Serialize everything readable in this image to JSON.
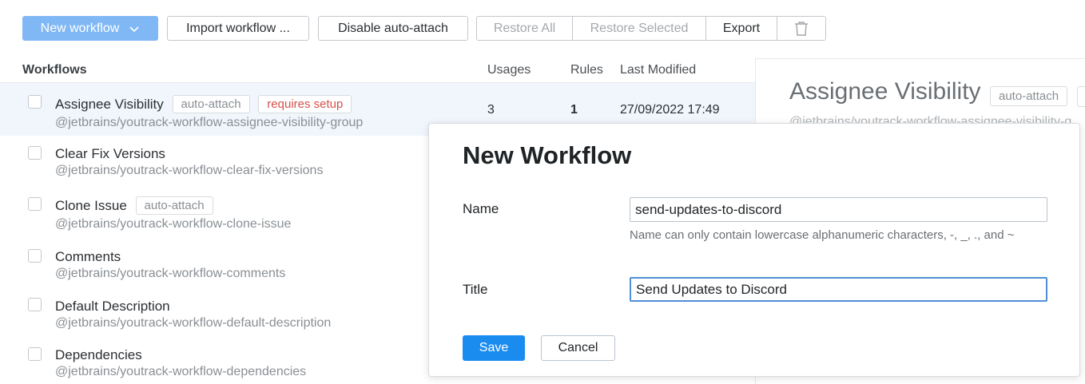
{
  "toolbar": {
    "new_workflow": "New workflow",
    "import_workflow": "Import workflow ...",
    "disable_auto_attach": "Disable auto-attach",
    "restore_all": "Restore All",
    "restore_selected": "Restore Selected",
    "export": "Export"
  },
  "table": {
    "headers": {
      "workflows": "Workflows",
      "usages": "Usages",
      "rules": "Rules",
      "last_modified": "Last Modified"
    },
    "rows": [
      {
        "title": "Assignee Visibility",
        "package": "@jetbrains/youtrack-workflow-assignee-visibility-group",
        "tags": [
          "auto-attach",
          "requires setup"
        ],
        "usages": "3",
        "rules": "1",
        "modified": "27/09/2022 17:49"
      },
      {
        "title": "Clear Fix Versions",
        "package": "@jetbrains/youtrack-workflow-clear-fix-versions"
      },
      {
        "title": "Clone Issue",
        "package": "@jetbrains/youtrack-workflow-clone-issue",
        "tags": [
          "auto-attach"
        ]
      },
      {
        "title": "Comments",
        "package": "@jetbrains/youtrack-workflow-comments"
      },
      {
        "title": "Default Description",
        "package": "@jetbrains/youtrack-workflow-default-description"
      },
      {
        "title": "Dependencies",
        "package": "@jetbrains/youtrack-workflow-dependencies"
      }
    ]
  },
  "side_panel": {
    "title": "Assignee Visibility",
    "tag": "auto-attach",
    "package": "@jetbrains/youtrack-workflow-assignee-visibility-g"
  },
  "dialog": {
    "title": "New Workflow",
    "name_label": "Name",
    "name_value": "send-updates-to-discord",
    "name_hint": "Name can only contain lowercase alphanumeric characters, -, _, ., and ~",
    "title_label": "Title",
    "title_value": "Send Updates to Discord",
    "save": "Save",
    "cancel": "Cancel"
  },
  "colors": {
    "accent": "#1a8cf0",
    "accent_light": "#80b8f5",
    "warning": "#d6504a"
  }
}
